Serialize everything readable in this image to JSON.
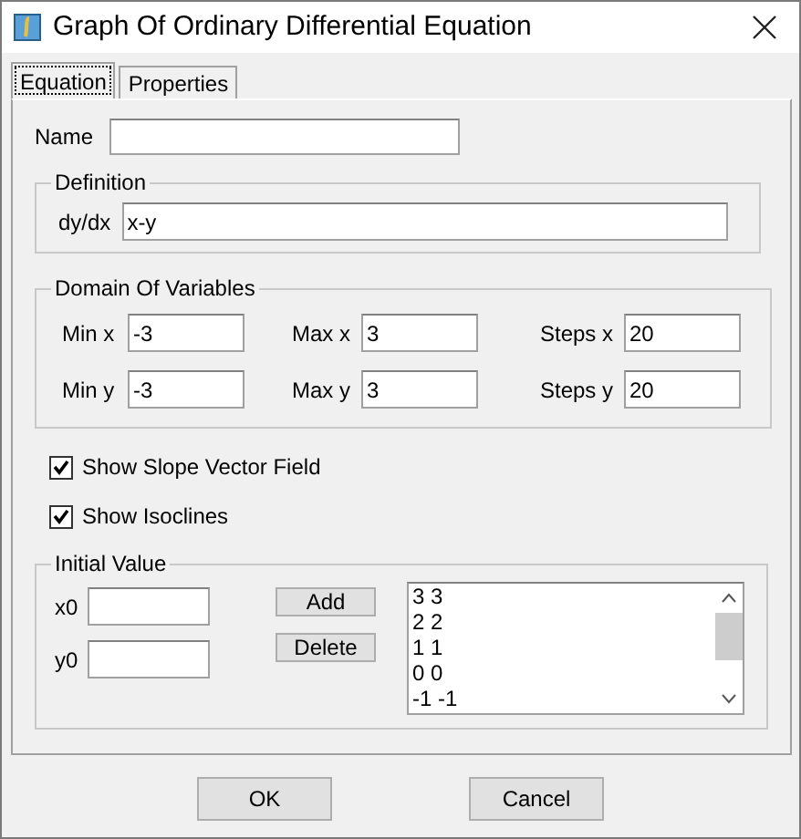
{
  "window": {
    "title": "Graph Of Ordinary Differential Equation"
  },
  "tabs": [
    {
      "label": "Equation",
      "selected": true
    },
    {
      "label": "Properties",
      "selected": false
    }
  ],
  "name_field": {
    "label": "Name"
  },
  "definition": {
    "title": "Definition",
    "label": "dy/dx",
    "value": "x-y"
  },
  "domain": {
    "title": "Domain Of Variables",
    "fields": [
      {
        "label": "Min x",
        "value": "-3"
      },
      {
        "label": "Max x",
        "value": "3"
      },
      {
        "label": "Steps x",
        "value": "20"
      },
      {
        "label": "Min y",
        "value": "-3"
      },
      {
        "label": "Max y",
        "value": "3"
      },
      {
        "label": "Steps y",
        "value": "20"
      }
    ]
  },
  "checkboxes": [
    {
      "label": "Show Slope Vector Field",
      "checked": true
    },
    {
      "label": "Show Isoclines",
      "checked": true
    }
  ],
  "initial_value": {
    "title": "Initial Value",
    "fields": [
      {
        "label": "x0"
      },
      {
        "label": "y0"
      }
    ],
    "buttons": [
      "Add",
      "Delete"
    ],
    "list": [
      "3 3",
      "2 2",
      "1 1",
      "0 0",
      "-1 -1"
    ]
  },
  "buttons": [
    "OK",
    "Cancel"
  ]
}
